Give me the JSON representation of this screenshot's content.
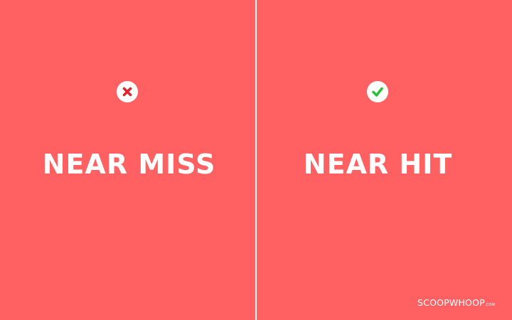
{
  "colors": {
    "background": "#FF6163",
    "text": "#FFFFFF",
    "divider": "#FFFFFF",
    "badge_background": "#FFFFFF",
    "cross_icon": "#E0252E",
    "check_icon": "#2DBE3C"
  },
  "left_panel": {
    "icon": "cross-icon",
    "label": "NEAR MISS"
  },
  "right_panel": {
    "icon": "check-icon",
    "label": "NEAR HIT"
  },
  "watermark": {
    "brand": "SCOOPWHOOP",
    "suffix": ".COM"
  }
}
